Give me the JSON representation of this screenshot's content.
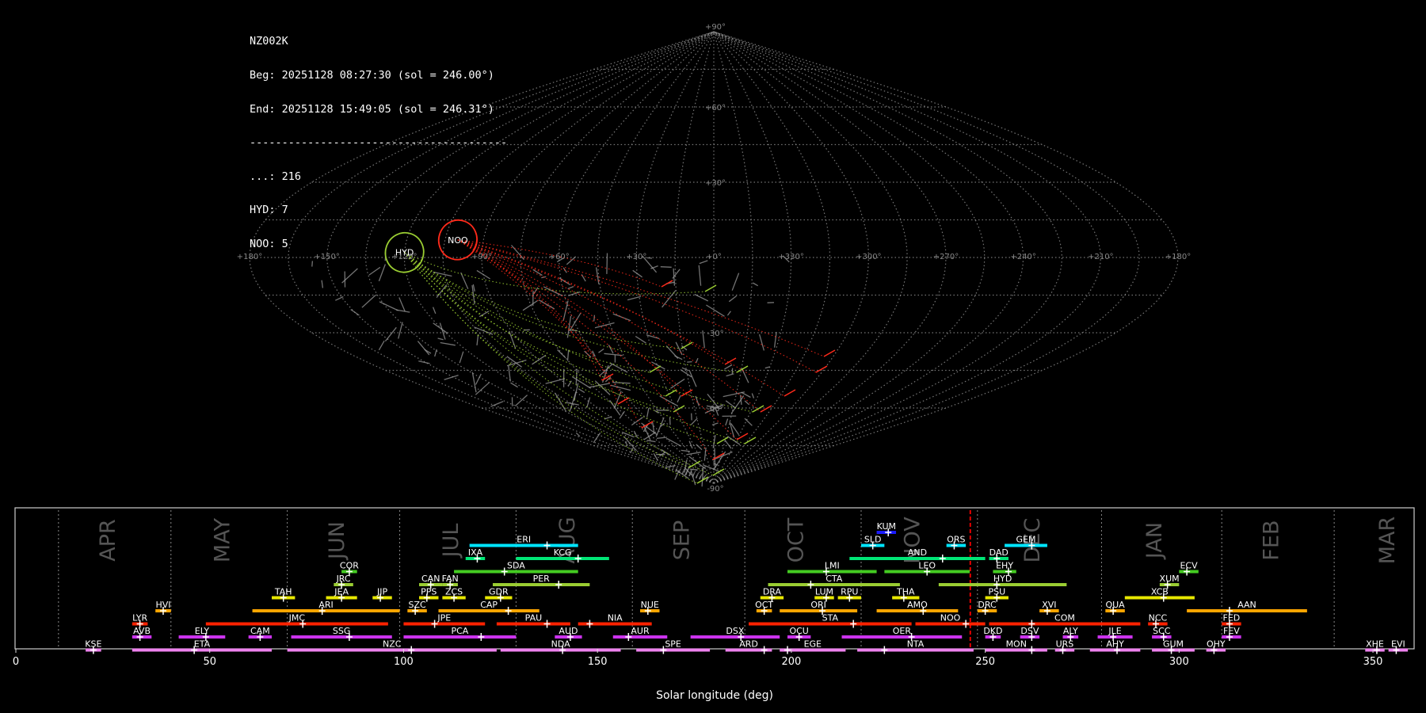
{
  "info": {
    "station": "NZ002K",
    "begin": "Beg: 20251128 08:27:30 (sol = 246.00°)",
    "end": "End: 20251128 15:49:05 (sol = 246.31°)",
    "divider": "----------------------------------------",
    "counts": [
      {
        "text": "...: 216"
      },
      {
        "text": "HYD: 7"
      },
      {
        "text": "NOO: 5"
      }
    ]
  },
  "colors": {
    "background": "#000000",
    "grid": "#8a8a8a",
    "sporadic": "#9a9a9a",
    "current_sol_line": "#ff0000",
    "HYD": "#9acd32",
    "NOO": "#ff2a1a"
  },
  "sky_map": {
    "projection": "sinusoidal",
    "lon_labels": [
      "+180°",
      "+150°",
      "+120°",
      "+90°",
      "+60°",
      "+30°",
      "+0°",
      "+330°",
      "+300°",
      "+270°",
      "+240°",
      "+210°",
      "+180°"
    ],
    "lat_labels": [
      "+90°",
      "+60°",
      "+30°",
      "-30°",
      "-60°",
      "-90°"
    ],
    "showers": [
      {
        "code": "HYD",
        "ra": 120,
        "dec": 2,
        "color": "#9acd32"
      },
      {
        "code": "NOO",
        "ra": 100,
        "dec": 7,
        "color": "#ff2a1a"
      }
    ]
  },
  "chart_data": {
    "type": "timeline",
    "xlabel": "Solar longitude (deg)",
    "xlim": [
      0,
      360
    ],
    "xticks": [
      0,
      50,
      100,
      150,
      200,
      250,
      300,
      350
    ],
    "current_sol": 246.15,
    "months": [
      {
        "name": "APR",
        "start": 11
      },
      {
        "name": "MAY",
        "start": 40
      },
      {
        "name": "JUN",
        "start": 70
      },
      {
        "name": "JUL",
        "start": 99
      },
      {
        "name": "AUG",
        "start": 129
      },
      {
        "name": "SEP",
        "start": 159
      },
      {
        "name": "OCT",
        "start": 188
      },
      {
        "name": "NOV",
        "start": 218
      },
      {
        "name": "DEC",
        "start": 248
      },
      {
        "name": "JAN",
        "start": 280
      },
      {
        "name": "FEB",
        "start": 311
      },
      {
        "name": "MAR",
        "start": 340
      }
    ],
    "showers": [
      {
        "code": "KUM",
        "start": 222,
        "end": 227,
        "peak": 225,
        "row": 9,
        "color": "#1a1aff"
      },
      {
        "code": "ERI",
        "start": 117,
        "end": 145,
        "peak": 137,
        "row": 8,
        "color": "#00e5ff"
      },
      {
        "code": "SLD",
        "start": 218,
        "end": 224,
        "peak": 221,
        "row": 8,
        "color": "#00e5ff"
      },
      {
        "code": "ORS",
        "start": 240,
        "end": 245,
        "peak": 242,
        "row": 8,
        "color": "#00e5ff"
      },
      {
        "code": "GEM",
        "start": 255,
        "end": 266,
        "peak": 262,
        "row": 8,
        "color": "#00e5ff"
      },
      {
        "code": "IXA",
        "start": 116,
        "end": 121,
        "peak": 119,
        "row": 7,
        "color": "#00e676"
      },
      {
        "code": "KCG",
        "start": 129,
        "end": 153,
        "peak": 145,
        "row": 7,
        "color": "#00e676"
      },
      {
        "code": "AND",
        "start": 215,
        "end": 250,
        "peak": 239,
        "row": 7,
        "color": "#00e676"
      },
      {
        "code": "DAD",
        "start": 251,
        "end": 256,
        "peak": 253,
        "row": 7,
        "color": "#00e676"
      },
      {
        "code": "COR",
        "start": 84,
        "end": 88,
        "peak": 86,
        "row": 6,
        "color": "#44cc22"
      },
      {
        "code": "SDA",
        "start": 113,
        "end": 145,
        "peak": 126,
        "row": 6,
        "color": "#44cc22"
      },
      {
        "code": "LMI",
        "start": 199,
        "end": 222,
        "peak": 209,
        "row": 6,
        "color": "#44cc22"
      },
      {
        "code": "LEO",
        "start": 224,
        "end": 246,
        "peak": 235,
        "row": 6,
        "color": "#44cc22"
      },
      {
        "code": "EHY",
        "start": 252,
        "end": 258,
        "peak": 256,
        "row": 6,
        "color": "#44cc22"
      },
      {
        "code": "ECV",
        "start": 300,
        "end": 305,
        "peak": 302,
        "row": 6,
        "color": "#44cc22"
      },
      {
        "code": "JRC",
        "start": 82,
        "end": 87,
        "peak": 84,
        "row": 5,
        "color": "#9acd32"
      },
      {
        "code": "CAN",
        "start": 104,
        "end": 110,
        "peak": 107,
        "row": 5,
        "color": "#9acd32"
      },
      {
        "code": "FAN",
        "start": 110,
        "end": 114,
        "peak": 112,
        "row": 5,
        "color": "#9acd32"
      },
      {
        "code": "PER",
        "start": 123,
        "end": 148,
        "peak": 140,
        "row": 5,
        "color": "#9acd32"
      },
      {
        "code": "CTA",
        "start": 194,
        "end": 228,
        "peak": 205,
        "row": 5,
        "color": "#9acd32"
      },
      {
        "code": "HYD",
        "start": 238,
        "end": 271,
        "peak": 253,
        "row": 5,
        "color": "#9acd32"
      },
      {
        "code": "XUM",
        "start": 295,
        "end": 300,
        "peak": 297,
        "row": 5,
        "color": "#9acd32"
      },
      {
        "code": "TAH",
        "start": 66,
        "end": 72,
        "peak": 69,
        "row": 4,
        "color": "#e8e800"
      },
      {
        "code": "JEA",
        "start": 80,
        "end": 88,
        "peak": 84,
        "row": 4,
        "color": "#e8e800"
      },
      {
        "code": "JIP",
        "start": 92,
        "end": 97,
        "peak": 94,
        "row": 4,
        "color": "#e8e800"
      },
      {
        "code": "PPS",
        "start": 104,
        "end": 109,
        "peak": 106,
        "row": 4,
        "color": "#e8e800"
      },
      {
        "code": "ZCS",
        "start": 110,
        "end": 116,
        "peak": 113,
        "row": 4,
        "color": "#e8e800"
      },
      {
        "code": "GDR",
        "start": 121,
        "end": 128,
        "peak": 125,
        "row": 4,
        "color": "#e8e800"
      },
      {
        "code": "DRA",
        "start": 192,
        "end": 198,
        "peak": 195,
        "row": 4,
        "color": "#e8e800"
      },
      {
        "code": "LUM",
        "start": 206,
        "end": 211,
        "peak": 209,
        "row": 4,
        "color": "#e8e800"
      },
      {
        "code": "RPU",
        "start": 212,
        "end": 218,
        "peak": 215,
        "row": 4,
        "color": "#e8e800"
      },
      {
        "code": "THA",
        "start": 226,
        "end": 233,
        "peak": 229,
        "row": 4,
        "color": "#e8e800"
      },
      {
        "code": "PSU",
        "start": 250,
        "end": 256,
        "peak": 253,
        "row": 4,
        "color": "#e8e800"
      },
      {
        "code": "XCB",
        "start": 286,
        "end": 304,
        "peak": 296,
        "row": 4,
        "color": "#e8e800"
      },
      {
        "code": "HVI",
        "start": 36,
        "end": 40,
        "peak": 38,
        "row": 3,
        "color": "#ffa500"
      },
      {
        "code": "ARI",
        "start": 61,
        "end": 99,
        "peak": 79,
        "row": 3,
        "color": "#ffa500"
      },
      {
        "code": "SZC",
        "start": 101,
        "end": 106,
        "peak": 103,
        "row": 3,
        "color": "#ffa500"
      },
      {
        "code": "CAP",
        "start": 109,
        "end": 135,
        "peak": 127,
        "row": 3,
        "color": "#ffa500"
      },
      {
        "code": "NUE",
        "start": 161,
        "end": 166,
        "peak": 163,
        "row": 3,
        "color": "#ffa500"
      },
      {
        "code": "OCT",
        "start": 191,
        "end": 195,
        "peak": 193,
        "row": 3,
        "color": "#ffa500"
      },
      {
        "code": "ORI",
        "start": 197,
        "end": 217,
        "peak": 208,
        "row": 3,
        "color": "#ffa500"
      },
      {
        "code": "AMO",
        "start": 222,
        "end": 243,
        "peak": 234,
        "row": 3,
        "color": "#ffa500"
      },
      {
        "code": "DRC",
        "start": 248,
        "end": 253,
        "peak": 250,
        "row": 3,
        "color": "#ffa500"
      },
      {
        "code": "XVI",
        "start": 264,
        "end": 269,
        "peak": 266,
        "row": 3,
        "color": "#ffa500"
      },
      {
        "code": "QUA",
        "start": 281,
        "end": 286,
        "peak": 283,
        "row": 3,
        "color": "#ffa500"
      },
      {
        "code": "AAN",
        "start": 302,
        "end": 333,
        "peak": 313,
        "row": 3,
        "color": "#ffa500"
      },
      {
        "code": "LYR",
        "start": 30,
        "end": 34,
        "peak": 32,
        "row": 2,
        "color": "#ff2200"
      },
      {
        "code": "JMC",
        "start": 49,
        "end": 96,
        "peak": 74,
        "row": 2,
        "color": "#ff2200"
      },
      {
        "code": "JPE",
        "start": 100,
        "end": 121,
        "peak": 108,
        "row": 2,
        "color": "#ff2200"
      },
      {
        "code": "PAU",
        "start": 124,
        "end": 143,
        "peak": 137,
        "row": 2,
        "color": "#ff2200"
      },
      {
        "code": "NIA",
        "start": 145,
        "end": 164,
        "peak": 148,
        "row": 2,
        "color": "#ff2200"
      },
      {
        "code": "STA",
        "start": 189,
        "end": 231,
        "peak": 216,
        "row": 2,
        "color": "#ff2200"
      },
      {
        "code": "NOO",
        "start": 232,
        "end": 250,
        "peak": 245,
        "row": 2,
        "color": "#ff2200"
      },
      {
        "code": "COM",
        "start": 251,
        "end": 290,
        "peak": 262,
        "row": 2,
        "color": "#ff2200"
      },
      {
        "code": "NCC",
        "start": 292,
        "end": 297,
        "peak": 294,
        "row": 2,
        "color": "#ff2200"
      },
      {
        "code": "FED",
        "start": 311,
        "end": 316,
        "peak": 313,
        "row": 2,
        "color": "#ff2200"
      },
      {
        "code": "AVB",
        "start": 30,
        "end": 35,
        "peak": 32,
        "row": 1,
        "color": "#cc33ee"
      },
      {
        "code": "ELY",
        "start": 42,
        "end": 54,
        "peak": 49,
        "row": 1,
        "color": "#cc33ee"
      },
      {
        "code": "CAM",
        "start": 60,
        "end": 66,
        "peak": 63,
        "row": 1,
        "color": "#cc33ee"
      },
      {
        "code": "SSG",
        "start": 71,
        "end": 97,
        "peak": 86,
        "row": 1,
        "color": "#cc33ee"
      },
      {
        "code": "PCA",
        "start": 100,
        "end": 129,
        "peak": 120,
        "row": 1,
        "color": "#cc33ee"
      },
      {
        "code": "AUD",
        "start": 139,
        "end": 146,
        "peak": 143,
        "row": 1,
        "color": "#cc33ee"
      },
      {
        "code": "AUR",
        "start": 154,
        "end": 168,
        "peak": 158,
        "row": 1,
        "color": "#cc33ee"
      },
      {
        "code": "DSX",
        "start": 174,
        "end": 197,
        "peak": 187,
        "row": 1,
        "color": "#cc33ee"
      },
      {
        "code": "OCU",
        "start": 199,
        "end": 205,
        "peak": 202,
        "row": 1,
        "color": "#cc33ee"
      },
      {
        "code": "OER",
        "start": 213,
        "end": 244,
        "peak": 231,
        "row": 1,
        "color": "#cc33ee"
      },
      {
        "code": "DKD",
        "start": 250,
        "end": 254,
        "peak": 252,
        "row": 1,
        "color": "#cc33ee"
      },
      {
        "code": "DSV",
        "start": 259,
        "end": 264,
        "peak": 262,
        "row": 1,
        "color": "#cc33ee"
      },
      {
        "code": "ALY",
        "start": 270,
        "end": 274,
        "peak": 272,
        "row": 1,
        "color": "#cc33ee"
      },
      {
        "code": "JLE",
        "start": 279,
        "end": 288,
        "peak": 283,
        "row": 1,
        "color": "#cc33ee"
      },
      {
        "code": "SCC",
        "start": 293,
        "end": 298,
        "peak": 296,
        "row": 1,
        "color": "#cc33ee"
      },
      {
        "code": "FEV",
        "start": 311,
        "end": 316,
        "peak": 313,
        "row": 1,
        "color": "#cc33ee"
      },
      {
        "code": "KSE",
        "start": 18,
        "end": 22,
        "peak": 20,
        "row": 0,
        "color": "#ee82ee"
      },
      {
        "code": "ETA",
        "start": 30,
        "end": 66,
        "peak": 46,
        "row": 0,
        "color": "#ee82ee"
      },
      {
        "code": "NZC",
        "start": 70,
        "end": 124,
        "peak": 102,
        "row": 0,
        "color": "#ee82ee"
      },
      {
        "code": "NDA",
        "start": 125,
        "end": 156,
        "peak": 141,
        "row": 0,
        "color": "#ee82ee"
      },
      {
        "code": "SPE",
        "start": 160,
        "end": 179,
        "peak": 167,
        "row": 0,
        "color": "#ee82ee"
      },
      {
        "code": "ARD",
        "start": 183,
        "end": 195,
        "peak": 193,
        "row": 0,
        "color": "#ee82ee"
      },
      {
        "code": "EGE",
        "start": 197,
        "end": 214,
        "peak": 199,
        "row": 0,
        "color": "#ee82ee"
      },
      {
        "code": "NTA",
        "start": 217,
        "end": 247,
        "peak": 224,
        "row": 0,
        "color": "#ee82ee"
      },
      {
        "code": "MON",
        "start": 250,
        "end": 266,
        "peak": 262,
        "row": 0,
        "color": "#ee82ee"
      },
      {
        "code": "URS",
        "start": 268,
        "end": 273,
        "peak": 270,
        "row": 0,
        "color": "#ee82ee"
      },
      {
        "code": "AHY",
        "start": 277,
        "end": 290,
        "peak": 284,
        "row": 0,
        "color": "#ee82ee"
      },
      {
        "code": "GUM",
        "start": 293,
        "end": 304,
        "peak": 298,
        "row": 0,
        "color": "#ee82ee"
      },
      {
        "code": "OHY",
        "start": 307,
        "end": 312,
        "peak": 309,
        "row": 0,
        "color": "#ee82ee"
      },
      {
        "code": "XHE",
        "start": 348,
        "end": 353,
        "peak": 351,
        "row": 0,
        "color": "#ee82ee"
      },
      {
        "code": "EVI",
        "start": 354,
        "end": 359,
        "peak": 356,
        "row": 0,
        "color": "#ee82ee"
      }
    ]
  }
}
